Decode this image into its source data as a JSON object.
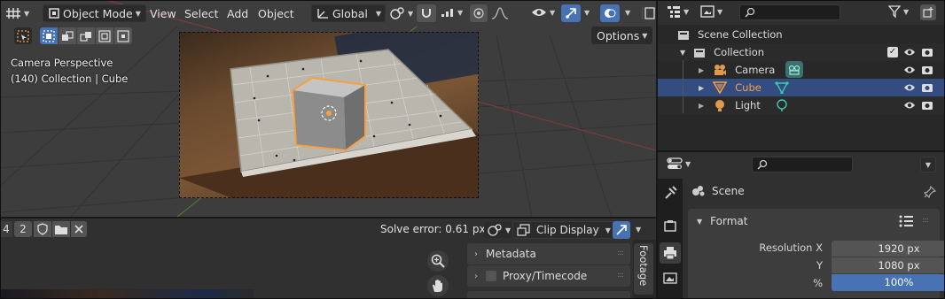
{
  "viewport": {
    "header": {
      "mode_label": "Object Mode",
      "menus": [
        "View",
        "Select",
        "Add",
        "Object"
      ],
      "orientation_label": "Global"
    },
    "options_label": "Options",
    "overlay": {
      "line1": "Camera Perspective",
      "line2": "(140) Collection | Cube"
    }
  },
  "clip_editor": {
    "tabs": [
      "4",
      "2"
    ],
    "solve_error": "Solve error: 0.61 px",
    "clip_display_label": "Clip Display",
    "panels": [
      "Metadata",
      "Proxy/Timecode"
    ],
    "side_tab": "Footage"
  },
  "outliner": {
    "scene_collection": "Scene Collection",
    "collection": "Collection",
    "items": [
      {
        "label": "Camera"
      },
      {
        "label": "Cube"
      },
      {
        "label": "Light"
      }
    ]
  },
  "properties": {
    "context": "Scene",
    "panel_title": "Format",
    "resolution_x_label": "Resolution X",
    "resolution_x_value": "1920 px",
    "resolution_y_label": "Y",
    "resolution_y_value": "1080 px",
    "percent_label": "%",
    "percent_value": "100%",
    "percent_fill": 1.0
  },
  "colors": {
    "accent_blue": "#4772b3",
    "selection_orange": "#f5a142",
    "row_highlight": "#334d80"
  }
}
